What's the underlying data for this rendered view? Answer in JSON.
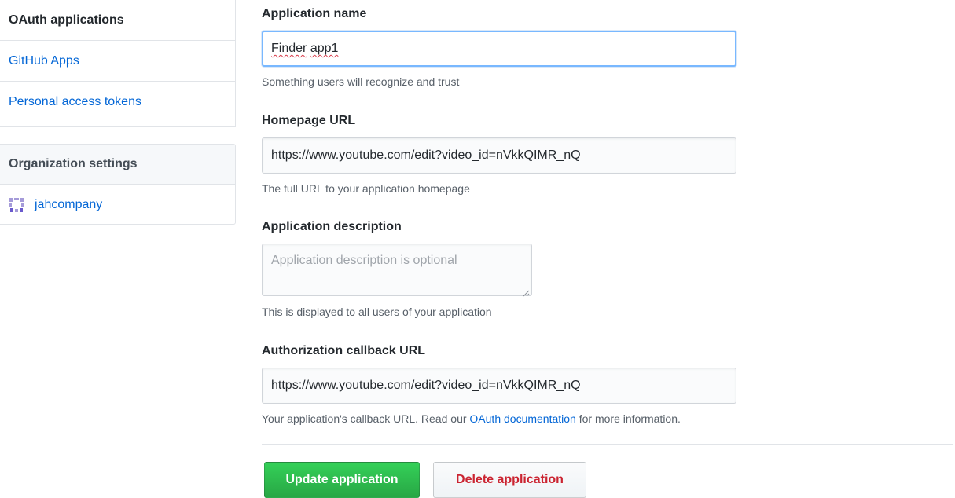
{
  "sidebar": {
    "items": [
      {
        "label": "OAuth applications"
      },
      {
        "label": "GitHub Apps"
      },
      {
        "label": "Personal access tokens"
      }
    ],
    "org_heading": "Organization settings",
    "org_item": {
      "label": "jahcompany",
      "icon": "org-avatar-icon"
    }
  },
  "form": {
    "app_name": {
      "label": "Application name",
      "value_word1": "Finder",
      "value_word2": "app1",
      "note": "Something users will recognize and trust"
    },
    "homepage": {
      "label": "Homepage URL",
      "value": "https://www.youtube.com/edit?video_id=nVkkQIMR_nQ",
      "note": "The full URL to your application homepage"
    },
    "description": {
      "label": "Application description",
      "placeholder": "Application description is optional",
      "note": "This is displayed to all users of your application"
    },
    "callback": {
      "label": "Authorization callback URL",
      "value": "https://www.youtube.com/edit?video_id=nVkkQIMR_nQ",
      "note_before": "Your application's callback URL. Read our ",
      "note_link": "OAuth documentation",
      "note_after": " for more information."
    }
  },
  "actions": {
    "update_label": "Update application",
    "delete_label": "Delete application"
  },
  "colors": {
    "link": "#0366d6",
    "primary_button": "#28a745",
    "danger_text": "#cb2431",
    "focus_border": "#79b8ff"
  }
}
